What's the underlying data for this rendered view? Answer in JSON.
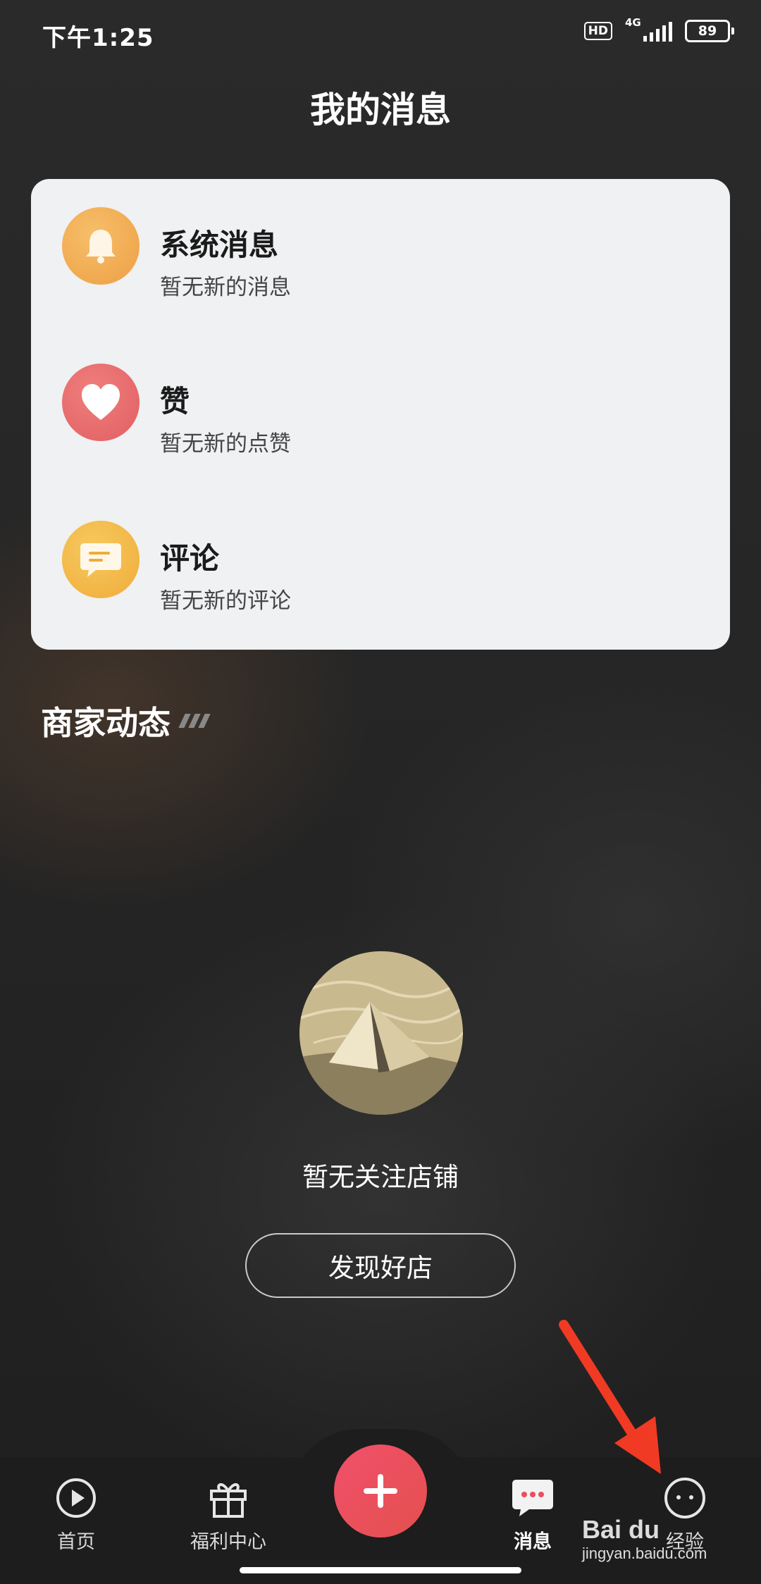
{
  "status_bar": {
    "time": "下午1:25",
    "hd_label": "HD",
    "network_label": "4G",
    "battery_level": "89"
  },
  "page": {
    "title": "我的消息"
  },
  "messages": [
    {
      "title": "系统消息",
      "subtitle": "暂无新的消息",
      "icon": "bell-icon",
      "color": "#f0a84a"
    },
    {
      "title": "赞",
      "subtitle": "暂无新的点赞",
      "icon": "heart-icon",
      "color": "#e9676b"
    },
    {
      "title": "评论",
      "subtitle": "暂无新的评论",
      "icon": "comment-icon",
      "color": "#f3b844"
    }
  ],
  "merchant_section": {
    "title": "商家动态",
    "empty_text": "暂无关注店铺",
    "discover_label": "发现好店"
  },
  "tabbar": {
    "home": "首页",
    "welfare": "福利中心",
    "messages": "消息",
    "experience": "经验",
    "active_tab": "消息",
    "plus_color": "#ea4f5e"
  },
  "watermark": {
    "logo_text": "Bai du",
    "url": "jingyan.baidu.com"
  },
  "colors": {
    "card_bg": "#eff1f2",
    "annotation_arrow": "#f03a24"
  }
}
